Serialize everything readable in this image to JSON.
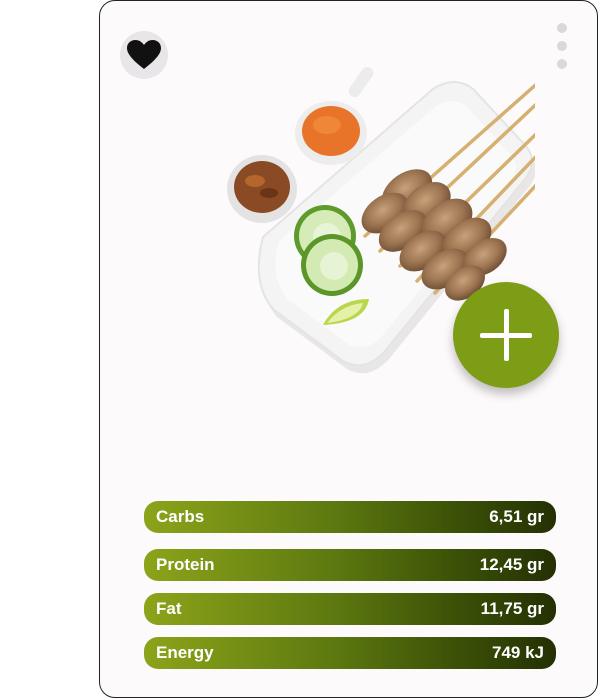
{
  "card": {
    "title": "",
    "subtitle": ""
  },
  "icons": {
    "favorite": "heart-icon",
    "more": "more-vertical-icon",
    "add": "plus-icon"
  },
  "colors": {
    "accent": "#7e9d17",
    "bar_start": "#8ca41a",
    "bar_end": "#243004"
  },
  "nutrition": [
    {
      "label": "Carbs",
      "value": "6,51 gr"
    },
    {
      "label": "Protein",
      "value": "12,45 gr"
    },
    {
      "label": "Fat",
      "value": "11,75 gr"
    },
    {
      "label": "Energy",
      "value": "749 kJ"
    }
  ]
}
